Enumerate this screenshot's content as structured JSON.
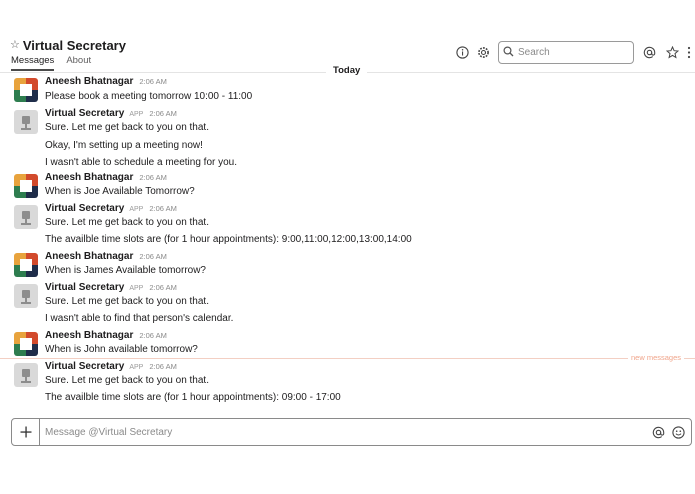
{
  "channel": {
    "title": "Virtual Secretary",
    "tabs": [
      {
        "label": "Messages",
        "active": true
      },
      {
        "label": "About",
        "active": false
      }
    ]
  },
  "header_icons": [
    "info-icon",
    "gear-icon",
    "at-icon",
    "star-icon",
    "more-vertical-icon"
  ],
  "search": {
    "placeholder": "Search",
    "value": ""
  },
  "day_divider": "Today",
  "new_messages_label": "new messages",
  "messages": [
    {
      "sender": "Aneesh Bhatnagar",
      "app": "",
      "time": "2:06 AM",
      "lines": [
        "Please book a meeting tomorrow 10:00 - 11:00"
      ]
    },
    {
      "sender": "Virtual Secretary",
      "app": "APP",
      "time": "2:06 AM",
      "lines": [
        "Sure. Let me get back to you on that.",
        "Okay, I'm setting up a meeting now!",
        "I wasn't able to schedule a meeting for you."
      ]
    },
    {
      "sender": "Aneesh Bhatnagar",
      "app": "",
      "time": "2:06 AM",
      "lines": [
        "When is Joe Available Tomorrow?"
      ]
    },
    {
      "sender": "Virtual Secretary",
      "app": "APP",
      "time": "2:06 AM",
      "lines": [
        "Sure. Let me get back to you on that.",
        "The availble time slots are (for 1 hour appointments): 9:00,11:00,12:00,13:00,14:00"
      ]
    },
    {
      "sender": "Aneesh Bhatnagar",
      "app": "",
      "time": "2:06 AM",
      "lines": [
        "When is James Available tomorrow?"
      ]
    },
    {
      "sender": "Virtual Secretary",
      "app": "APP",
      "time": "2:06 AM",
      "lines": [
        "Sure. Let me get back to you on that.",
        "I wasn't able to find that person's calendar."
      ]
    },
    {
      "sender": "Aneesh Bhatnagar",
      "app": "",
      "time": "2:06 AM",
      "lines": [
        "When is John available tomorrow?"
      ]
    },
    {
      "sender": "Virtual Secretary",
      "app": "APP",
      "time": "2:06 AM",
      "lines": [
        "Sure. Let me get back to you on that.",
        "The availble time slots are (for 1 hour appointments): 09:00 - 17:00"
      ]
    }
  ],
  "composer": {
    "placeholder": "Message @Virtual Secretary",
    "value": ""
  },
  "colors": {
    "new_messages": "#f0a58b",
    "text": "#1d1c1d",
    "muted": "#8a8a8a"
  }
}
